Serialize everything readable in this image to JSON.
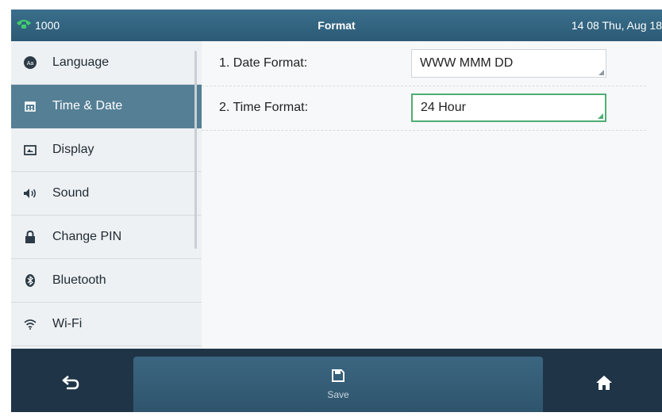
{
  "topbar": {
    "line_id": "1000",
    "title": "Format",
    "datetime": "14 08 Thu, Aug 18"
  },
  "sidebar": {
    "items": [
      {
        "label": "Language",
        "icon": "language-icon"
      },
      {
        "label": "Time & Date",
        "icon": "calendar-icon",
        "active": true
      },
      {
        "label": "Display",
        "icon": "display-icon"
      },
      {
        "label": "Sound",
        "icon": "speaker-icon"
      },
      {
        "label": "Change PIN",
        "icon": "lock-icon"
      },
      {
        "label": "Bluetooth",
        "icon": "bluetooth-icon"
      },
      {
        "label": "Wi-Fi",
        "icon": "wifi-icon"
      }
    ]
  },
  "form": {
    "rows": [
      {
        "label": "1. Date Format:",
        "value": "WWW MMM DD"
      },
      {
        "label": "2. Time Format:",
        "value": "24 Hour",
        "focused": true
      }
    ]
  },
  "softkeys": {
    "back_icon": "back-arrow-icon",
    "save_label": "Save",
    "save_icon": "save-icon",
    "home_icon": "home-icon"
  },
  "colors": {
    "accent": "#547f95",
    "focus": "#4fae73",
    "phone_icon": "#3ecf6a"
  }
}
